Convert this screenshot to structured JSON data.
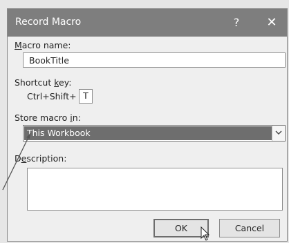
{
  "dialog": {
    "title": "Record Macro",
    "help_glyph": "?",
    "close_glyph": "✕"
  },
  "macro_name": {
    "label_prefix": "",
    "label_accel": "M",
    "label_rest": "acro name:",
    "value": "BookTitle"
  },
  "shortcut": {
    "label_pre": "Shortcut ",
    "label_accel": "k",
    "label_rest": "ey:",
    "prefix": "Ctrl+Shift+",
    "key": "T"
  },
  "store_in": {
    "label_pre": "Store macro ",
    "label_accel": "i",
    "label_rest": "n:",
    "selected": "This Workbook"
  },
  "description": {
    "label_pre": "D",
    "label_accel": "e",
    "label_rest": "scription:",
    "value": ""
  },
  "buttons": {
    "ok": "OK",
    "cancel": "Cancel"
  },
  "icons": {
    "dropdown": "chevron-down-icon",
    "cursor": "mouse-pointer-icon"
  }
}
